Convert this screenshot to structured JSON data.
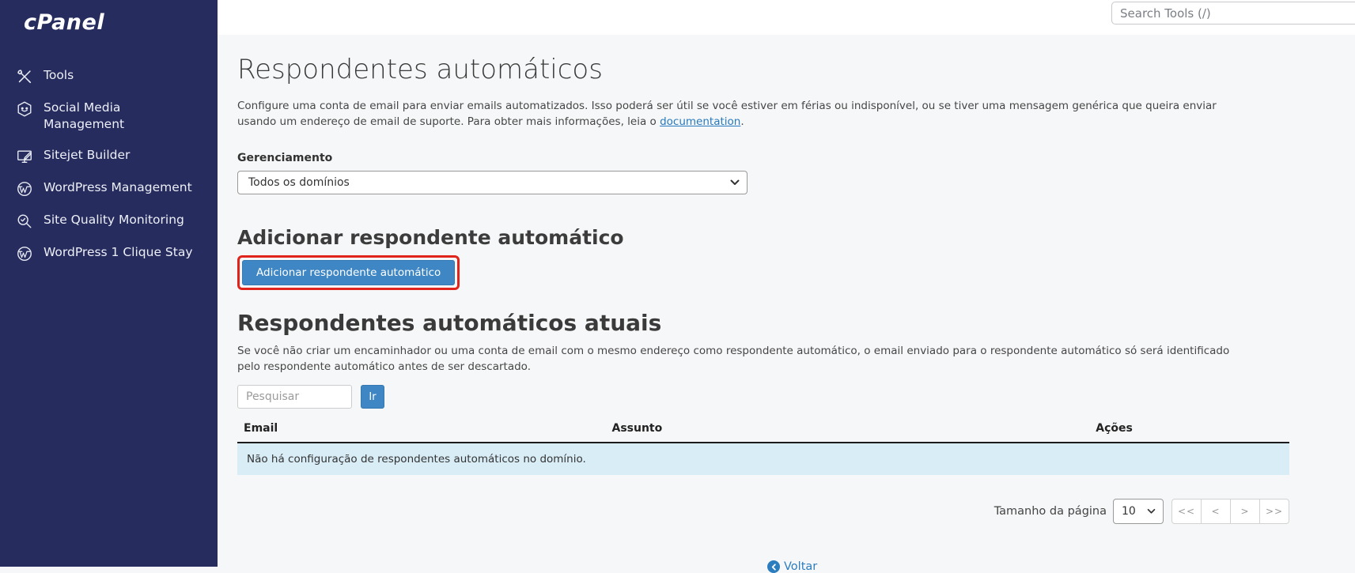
{
  "topbar": {
    "search_placeholder": "Search Tools (/)"
  },
  "sidebar": {
    "logo": "cPanel",
    "items": [
      {
        "label": "Tools",
        "icon": "tools-icon"
      },
      {
        "label": "Social Media Management",
        "icon": "social-media-icon"
      },
      {
        "label": "Sitejet Builder",
        "icon": "sitejet-icon"
      },
      {
        "label": "WordPress Management",
        "icon": "wordpress-icon"
      },
      {
        "label": "Site Quality Monitoring",
        "icon": "site-quality-icon"
      },
      {
        "label": "WordPress 1 Clique Stay",
        "icon": "wordpress-icon"
      }
    ]
  },
  "page": {
    "title": "Respondentes automáticos",
    "intro_text": "Configure uma conta de email para enviar emails automatizados. Isso poderá ser útil se você estiver em férias ou indisponível, ou se tiver uma mensagem genérica que queira enviar usando um endereço de email de suporte. Para obter mais informações, leia o ",
    "intro_link": "documentation",
    "intro_suffix": ".",
    "management_label": "Gerenciamento",
    "domain_select_value": "Todos os domínios",
    "add_section": {
      "heading": "Adicionar respondente automático",
      "button_label": "Adicionar respondente automático"
    },
    "current_section": {
      "heading": "Respondentes automáticos atuais",
      "description": "Se você não criar um encaminhador ou uma conta de email com o mesmo endereço como respondente automático, o email enviado para o respondente automático só será identificado pelo respondente automático antes de ser descartado.",
      "search_placeholder": "Pesquisar",
      "go_button": "Ir"
    },
    "table": {
      "columns": [
        "Email",
        "Assunto",
        "Ações"
      ],
      "empty_message": "Não há configuração de respondentes automáticos no domínio."
    },
    "pagination": {
      "page_size_label": "Tamanho da página",
      "page_size_value": "10",
      "buttons": [
        "<<",
        "<",
        ">",
        ">>"
      ]
    },
    "footer": {
      "back_label": "Voltar"
    }
  },
  "colors": {
    "sidebar_bg": "#262c5d",
    "button_blue": "#3e86c4",
    "annotation_red": "#e0241b",
    "empty_row_bg": "#d9edf7",
    "link_blue": "#2779bd"
  }
}
